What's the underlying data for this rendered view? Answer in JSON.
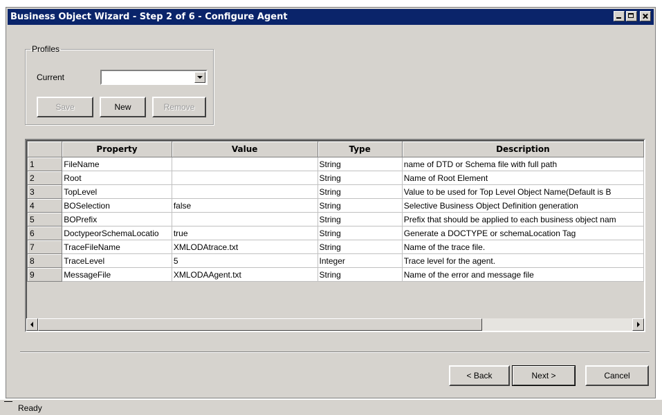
{
  "window": {
    "title": "Business Object Wizard - Step 2 of 6 - Configure Agent"
  },
  "profiles": {
    "legend": "Profiles",
    "current_label": "Current",
    "current_value": "",
    "buttons": {
      "save": "Save",
      "new": "New",
      "remove": "Remove"
    }
  },
  "grid": {
    "columns": [
      "",
      "Property",
      "Value",
      "Type",
      "Description"
    ],
    "rows": [
      {
        "num": "1",
        "property": "FileName",
        "value": "",
        "type": "String",
        "description": "name of DTD or Schema file with full path"
      },
      {
        "num": "2",
        "property": "Root",
        "value": "",
        "type": "String",
        "description": "Name of Root Element"
      },
      {
        "num": "3",
        "property": "TopLevel",
        "value": "",
        "type": "String",
        "description": "Value to be used for Top Level Object Name(Default is B"
      },
      {
        "num": "4",
        "property": "BOSelection",
        "value": "false",
        "type": "String",
        "description": "Selective Business Object Definition generation"
      },
      {
        "num": "5",
        "property": "BOPrefix",
        "value": "",
        "type": "String",
        "description": "Prefix that should be applied to each business object nam"
      },
      {
        "num": "6",
        "property": "DoctypeorSchemaLocatio",
        "value": "true",
        "type": "String",
        "description": "Generate a DOCTYPE or schemaLocation Tag"
      },
      {
        "num": "7",
        "property": "TraceFileName",
        "value": "XMLODAtrace.txt",
        "type": "String",
        "description": "Name of the trace file."
      },
      {
        "num": "8",
        "property": "TraceLevel",
        "value": "5",
        "type": "Integer",
        "description": "Trace level for the agent."
      },
      {
        "num": "9",
        "property": "MessageFile",
        "value": "XMLODAAgent.txt",
        "type": "String",
        "description": "Name of the error and message file"
      }
    ]
  },
  "nav": {
    "back": "< Back",
    "next": "Next >",
    "cancel": "Cancel"
  },
  "status": {
    "text": "Ready"
  }
}
